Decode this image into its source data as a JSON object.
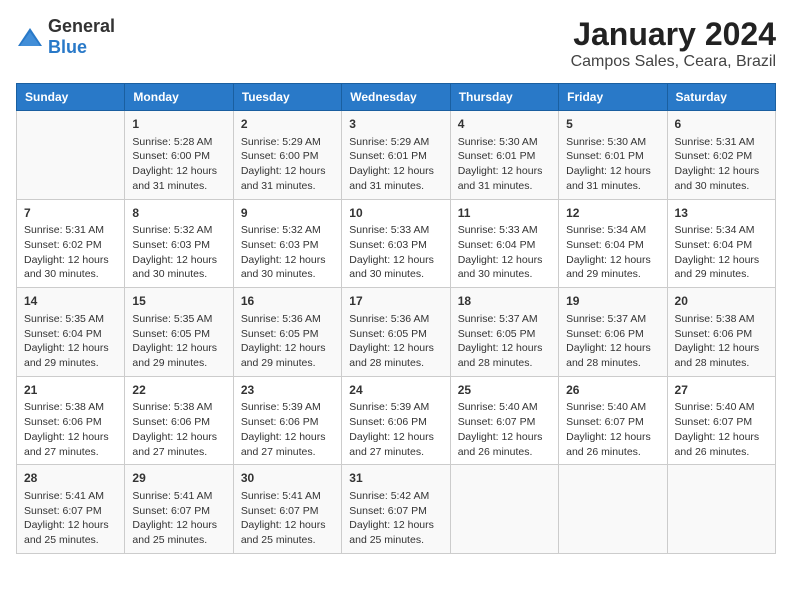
{
  "logo": {
    "general": "General",
    "blue": "Blue"
  },
  "title": "January 2024",
  "subtitle": "Campos Sales, Ceara, Brazil",
  "headers": [
    "Sunday",
    "Monday",
    "Tuesday",
    "Wednesday",
    "Thursday",
    "Friday",
    "Saturday"
  ],
  "weeks": [
    [
      {
        "day": "",
        "info": ""
      },
      {
        "day": "1",
        "info": "Sunrise: 5:28 AM\nSunset: 6:00 PM\nDaylight: 12 hours\nand 31 minutes."
      },
      {
        "day": "2",
        "info": "Sunrise: 5:29 AM\nSunset: 6:00 PM\nDaylight: 12 hours\nand 31 minutes."
      },
      {
        "day": "3",
        "info": "Sunrise: 5:29 AM\nSunset: 6:01 PM\nDaylight: 12 hours\nand 31 minutes."
      },
      {
        "day": "4",
        "info": "Sunrise: 5:30 AM\nSunset: 6:01 PM\nDaylight: 12 hours\nand 31 minutes."
      },
      {
        "day": "5",
        "info": "Sunrise: 5:30 AM\nSunset: 6:01 PM\nDaylight: 12 hours\nand 31 minutes."
      },
      {
        "day": "6",
        "info": "Sunrise: 5:31 AM\nSunset: 6:02 PM\nDaylight: 12 hours\nand 30 minutes."
      }
    ],
    [
      {
        "day": "7",
        "info": "Sunrise: 5:31 AM\nSunset: 6:02 PM\nDaylight: 12 hours\nand 30 minutes."
      },
      {
        "day": "8",
        "info": "Sunrise: 5:32 AM\nSunset: 6:03 PM\nDaylight: 12 hours\nand 30 minutes."
      },
      {
        "day": "9",
        "info": "Sunrise: 5:32 AM\nSunset: 6:03 PM\nDaylight: 12 hours\nand 30 minutes."
      },
      {
        "day": "10",
        "info": "Sunrise: 5:33 AM\nSunset: 6:03 PM\nDaylight: 12 hours\nand 30 minutes."
      },
      {
        "day": "11",
        "info": "Sunrise: 5:33 AM\nSunset: 6:04 PM\nDaylight: 12 hours\nand 30 minutes."
      },
      {
        "day": "12",
        "info": "Sunrise: 5:34 AM\nSunset: 6:04 PM\nDaylight: 12 hours\nand 29 minutes."
      },
      {
        "day": "13",
        "info": "Sunrise: 5:34 AM\nSunset: 6:04 PM\nDaylight: 12 hours\nand 29 minutes."
      }
    ],
    [
      {
        "day": "14",
        "info": "Sunrise: 5:35 AM\nSunset: 6:04 PM\nDaylight: 12 hours\nand 29 minutes."
      },
      {
        "day": "15",
        "info": "Sunrise: 5:35 AM\nSunset: 6:05 PM\nDaylight: 12 hours\nand 29 minutes."
      },
      {
        "day": "16",
        "info": "Sunrise: 5:36 AM\nSunset: 6:05 PM\nDaylight: 12 hours\nand 29 minutes."
      },
      {
        "day": "17",
        "info": "Sunrise: 5:36 AM\nSunset: 6:05 PM\nDaylight: 12 hours\nand 28 minutes."
      },
      {
        "day": "18",
        "info": "Sunrise: 5:37 AM\nSunset: 6:05 PM\nDaylight: 12 hours\nand 28 minutes."
      },
      {
        "day": "19",
        "info": "Sunrise: 5:37 AM\nSunset: 6:06 PM\nDaylight: 12 hours\nand 28 minutes."
      },
      {
        "day": "20",
        "info": "Sunrise: 5:38 AM\nSunset: 6:06 PM\nDaylight: 12 hours\nand 28 minutes."
      }
    ],
    [
      {
        "day": "21",
        "info": "Sunrise: 5:38 AM\nSunset: 6:06 PM\nDaylight: 12 hours\nand 27 minutes."
      },
      {
        "day": "22",
        "info": "Sunrise: 5:38 AM\nSunset: 6:06 PM\nDaylight: 12 hours\nand 27 minutes."
      },
      {
        "day": "23",
        "info": "Sunrise: 5:39 AM\nSunset: 6:06 PM\nDaylight: 12 hours\nand 27 minutes."
      },
      {
        "day": "24",
        "info": "Sunrise: 5:39 AM\nSunset: 6:06 PM\nDaylight: 12 hours\nand 27 minutes."
      },
      {
        "day": "25",
        "info": "Sunrise: 5:40 AM\nSunset: 6:07 PM\nDaylight: 12 hours\nand 26 minutes."
      },
      {
        "day": "26",
        "info": "Sunrise: 5:40 AM\nSunset: 6:07 PM\nDaylight: 12 hours\nand 26 minutes."
      },
      {
        "day": "27",
        "info": "Sunrise: 5:40 AM\nSunset: 6:07 PM\nDaylight: 12 hours\nand 26 minutes."
      }
    ],
    [
      {
        "day": "28",
        "info": "Sunrise: 5:41 AM\nSunset: 6:07 PM\nDaylight: 12 hours\nand 25 minutes."
      },
      {
        "day": "29",
        "info": "Sunrise: 5:41 AM\nSunset: 6:07 PM\nDaylight: 12 hours\nand 25 minutes."
      },
      {
        "day": "30",
        "info": "Sunrise: 5:41 AM\nSunset: 6:07 PM\nDaylight: 12 hours\nand 25 minutes."
      },
      {
        "day": "31",
        "info": "Sunrise: 5:42 AM\nSunset: 6:07 PM\nDaylight: 12 hours\nand 25 minutes."
      },
      {
        "day": "",
        "info": ""
      },
      {
        "day": "",
        "info": ""
      },
      {
        "day": "",
        "info": ""
      }
    ]
  ]
}
